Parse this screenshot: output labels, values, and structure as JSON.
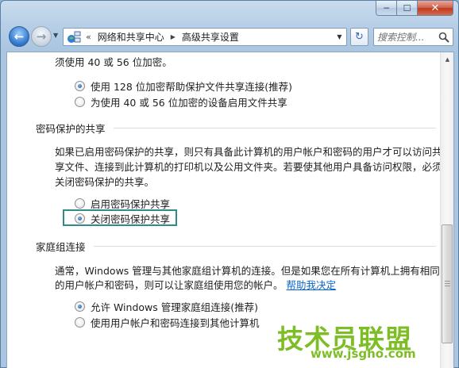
{
  "window": {
    "minimize_glyph": "─",
    "maximize_glyph": "☐",
    "close_glyph": "✕"
  },
  "nav": {
    "back_icon": "back-arrow-icon",
    "forward_icon": "forward-arrow-icon",
    "chevron": "«",
    "breadcrumb": [
      "网络和共享中心",
      "高级共享设置"
    ],
    "search_placeholder": "搜索控制..."
  },
  "content": {
    "top_paragraph_line": "须使用 40 或 56 位加密。",
    "encryption_options": [
      {
        "label": "使用 128 位加密帮助保护文件共享连接(推荐)",
        "checked": true
      },
      {
        "label": "为使用 40 或 56 位加密的设备启用文件共享",
        "checked": false
      }
    ],
    "password_section": {
      "title": "密码保护的共享",
      "description": [
        "如果已启用密码保护的共享，则只有具备此计算机的用户帐户和密码的用户才可以访问共",
        "享文件、连接到此计算机的打印机以及公用文件夹。若要使其他用户具备访问权限，必须",
        "关闭密码保护的共享。"
      ],
      "options": [
        {
          "label": "启用密码保护共享",
          "checked": false
        },
        {
          "label": "关闭密码保护共享",
          "checked": true
        }
      ]
    },
    "homegroup_section": {
      "title": "家庭组连接",
      "description_line1": "通常，Windows 管理与其他家庭组计算机的连接。但是如果您在所有计算机上拥有相同",
      "description_line2": "的用户帐户和密码，则可以让家庭组使用您的帐户。",
      "help_link": "帮助我决定",
      "options": [
        {
          "label": "允许 Windows 管理家庭组连接(推荐)",
          "checked": true
        },
        {
          "label": "使用用户帐户和密码连接到其他计算机",
          "checked": false
        }
      ]
    }
  },
  "watermark": {
    "main": "技术员联盟",
    "sub": "www.jsgho.com"
  },
  "colors": {
    "highlight_box": "#2e8c88",
    "link": "#0b63c9",
    "watermark": "#7dbd25"
  }
}
